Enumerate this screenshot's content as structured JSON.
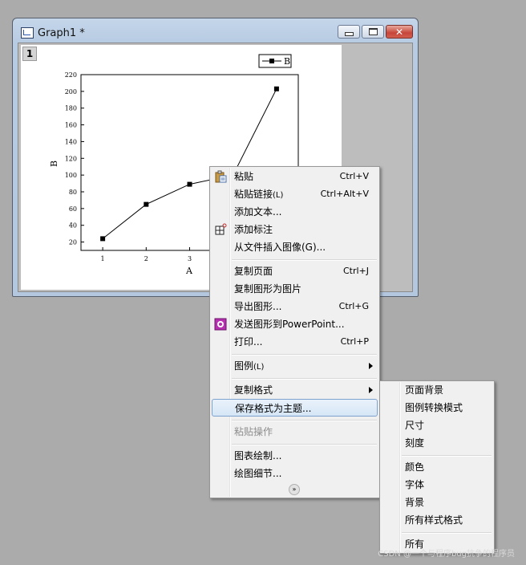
{
  "window": {
    "title": "Graph1 *",
    "layer_number": "1"
  },
  "chart_data": {
    "type": "line",
    "x": [
      1,
      2,
      3,
      4,
      5
    ],
    "series": [
      {
        "name": "B",
        "values": [
          24,
          65,
          89,
          100,
          203
        ]
      }
    ],
    "xlabel": "A",
    "ylabel": "B",
    "xlim": [
      0.5,
      5.5
    ],
    "ylim": [
      10,
      220
    ],
    "yticks": [
      20,
      40,
      60,
      80,
      100,
      120,
      140,
      160,
      180,
      200,
      220
    ],
    "xticks_visible": [
      1,
      2,
      3
    ],
    "legend_position": "top-right",
    "grid": false
  },
  "context_menu": {
    "items": [
      {
        "label": "粘贴",
        "shortcut": "Ctrl+V",
        "icon": "paste-icon"
      },
      {
        "label": "粘贴链接",
        "suffix": "(L)",
        "shortcut": "Ctrl+Alt+V"
      },
      {
        "label": "添加文本..."
      },
      {
        "label": "添加标注",
        "icon": "annotation-icon"
      },
      {
        "label": "从文件插入图像(G)..."
      },
      {
        "label": "复制页面",
        "shortcut": "Ctrl+J"
      },
      {
        "label": "复制图形为图片"
      },
      {
        "label": "导出图形...",
        "shortcut": "Ctrl+G"
      },
      {
        "label": "发送图形到PowerPoint...",
        "icon": "powerpoint-icon"
      },
      {
        "label": "打印...",
        "shortcut": "Ctrl+P"
      },
      {
        "label": "图例",
        "suffix": "(L)"
      },
      {
        "label": "复制格式"
      },
      {
        "label": "保存格式为主题..."
      },
      {
        "label": "粘贴操作"
      },
      {
        "label": "图表绘制..."
      },
      {
        "label": "绘图细节..."
      }
    ]
  },
  "submenu": {
    "items": [
      "页面背景",
      "图例转换模式",
      "尺寸",
      "刻度",
      "颜色",
      "字体",
      "背景",
      "所有样式格式",
      "所有"
    ]
  },
  "watermark": "CSDN @一个与程序bug抗争的程序员",
  "colors": {
    "desktop": "#ababab",
    "menu_bg": "#f0f0f0",
    "highlight_border": "#7da2ce"
  }
}
